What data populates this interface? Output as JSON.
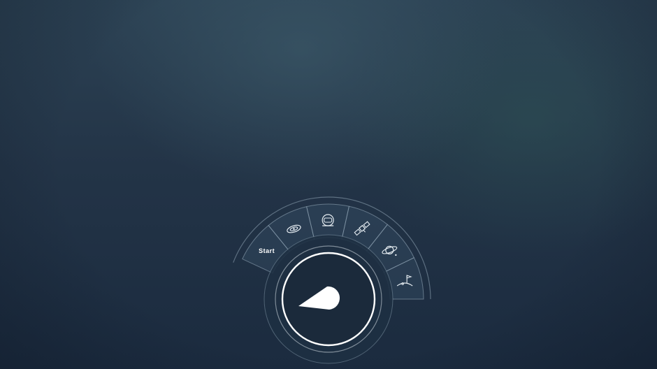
{
  "menu": {
    "items": [
      {
        "label": "Start",
        "icon": "start-label"
      },
      {
        "label": "",
        "icon": "galaxy-icon"
      },
      {
        "label": "",
        "icon": "astronaut-helmet-icon"
      },
      {
        "label": "",
        "icon": "satellite-icon"
      },
      {
        "label": "",
        "icon": "planet-icon"
      },
      {
        "label": "",
        "icon": "moon-flag-icon"
      }
    ],
    "center": {
      "icon": "comet-icon"
    }
  },
  "colors": {
    "background_top": "#2c4254",
    "background_bottom": "#1b2b3f",
    "segment_line": "#8fa4b4",
    "icon_stroke": "#e6edf2",
    "center_fill": "#ffffff"
  }
}
